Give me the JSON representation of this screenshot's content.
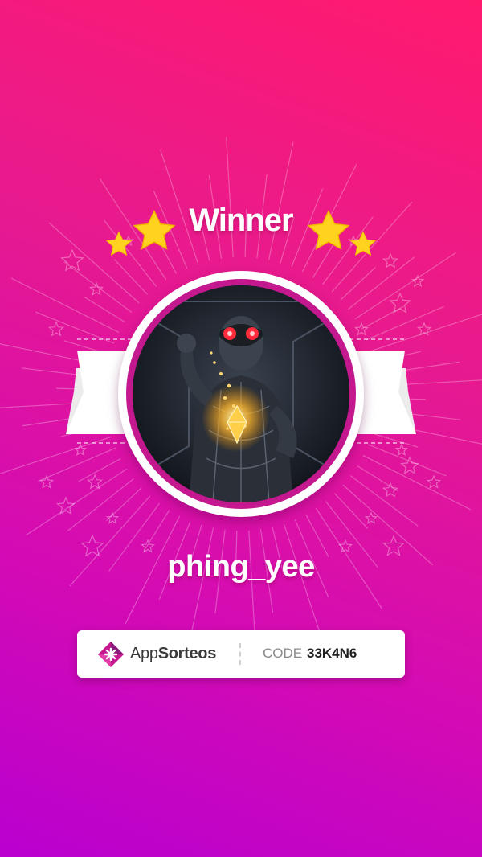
{
  "header": {
    "title": "Winner"
  },
  "winner": {
    "username": "phing_yee",
    "avatar_alt": "winner-avatar"
  },
  "footer": {
    "brand_light": "App",
    "brand_bold": "Sorteos",
    "code_label": "CODE",
    "code_value": "33K4N6"
  },
  "colors": {
    "bg_top": "#ff1a6e",
    "bg_bottom": "#b900cf",
    "star": "#ffd21f",
    "ring_accent": "#c4188f",
    "logo_accent": "#c4188f"
  }
}
